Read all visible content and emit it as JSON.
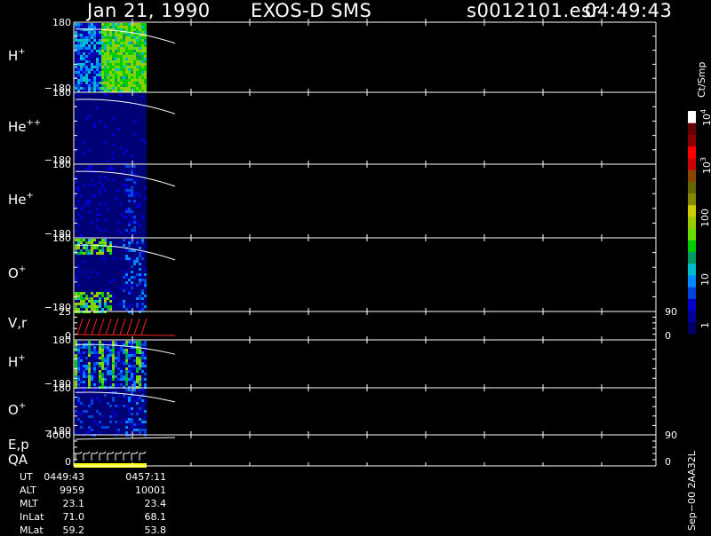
{
  "header": {
    "date": "Jan 21, 1990",
    "instrument": "EXOS-D SMS",
    "file": "s0012101.esr",
    "time": "04:49:43"
  },
  "panels": [
    {
      "label": "H",
      "sup": "+",
      "y_top": "180",
      "y_bottom": "−180"
    },
    {
      "label": "He",
      "sup": "++",
      "y_top": "180",
      "y_bottom": "−180"
    },
    {
      "label": "He",
      "sup": "+",
      "y_top": "180",
      "y_bottom": "−180"
    },
    {
      "label": "O",
      "sup": "+",
      "y_top": "180",
      "y_bottom": "−180"
    },
    {
      "label": "V,r",
      "sup": "",
      "y_top": "25",
      "y_bottom": "0",
      "right_top": "90",
      "right_bottom": "0"
    },
    {
      "label": "H",
      "sup": "+",
      "y_top": "180",
      "y_bottom": "−180"
    },
    {
      "label": "O",
      "sup": "+",
      "y_top": "180",
      "y_bottom": "−180"
    },
    {
      "label": "E,p",
      "label2": "QA",
      "sup": "",
      "y_top": "4000",
      "y_bottom": "0",
      "right_top": "90",
      "right_bottom": "0"
    }
  ],
  "colorbar": {
    "title": "Ct/Smp",
    "ticks": [
      {
        "base": "1",
        "sup": ""
      },
      {
        "base": "10",
        "sup": ""
      },
      {
        "base": "100",
        "sup": ""
      },
      {
        "base": "10",
        "sup": "3"
      },
      {
        "base": "10",
        "sup": "4"
      }
    ],
    "colors": [
      "#000066",
      "#000099",
      "#0000cc",
      "#0044dd",
      "#0088ff",
      "#00bbcc",
      "#009966",
      "#00cc00",
      "#66dd00",
      "#99cc00",
      "#cccc00",
      "#888800",
      "#666600",
      "#884400",
      "#cc0000",
      "#ff0000",
      "#880000",
      "#660000",
      "#ffffff"
    ]
  },
  "ephemeris": {
    "rows": [
      {
        "name": "UT",
        "start": "0449:43",
        "end": "0457:11"
      },
      {
        "name": "ALT",
        "start": "9959",
        "end": "10001"
      },
      {
        "name": "MLT",
        "start": "23.1",
        "end": "23.4"
      },
      {
        "name": "InLat",
        "start": "71.0",
        "end": "68.1"
      },
      {
        "name": "MLat",
        "start": "59.2",
        "end": "53.8"
      }
    ]
  },
  "footer_note": "Sep−00  2AA32L",
  "chart_data": {
    "type": "heatmap",
    "title": "Jan 21, 1990   EXOS-D SMS",
    "panels": [
      "H+",
      "He++",
      "He+",
      "O+",
      "V,r",
      "H+",
      "O+",
      "E,p / QA"
    ],
    "y_ranges": [
      [
        -180,
        180
      ],
      [
        -180,
        180
      ],
      [
        -180,
        180
      ],
      [
        -180,
        180
      ],
      [
        0,
        25
      ],
      [
        -180,
        180
      ],
      [
        -180,
        180
      ],
      [
        0,
        4000
      ]
    ],
    "right_axis_ranges": {
      "V,r": [
        0,
        90
      ],
      "E,p": [
        0,
        90
      ]
    },
    "x_range": [
      "0449:43",
      "0457:11"
    ],
    "colorbar": {
      "label": "Ct/Smp",
      "scale": "log",
      "range": [
        1,
        10000
      ]
    }
  }
}
